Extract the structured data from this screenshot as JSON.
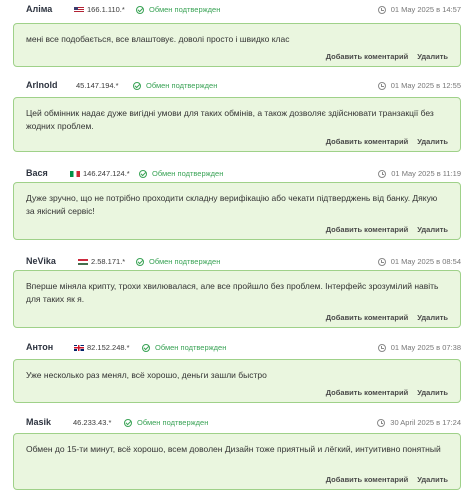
{
  "reviews": [
    {
      "name": "Аліма",
      "ip": "166.1.110.*",
      "flag": "us",
      "status": "Обмен подтвержден",
      "date": "01 May 2025 в 14:57",
      "text": "мені все подобається, все влаштовує. доволі просто і швидко клас",
      "add": "Добавить коментарий",
      "del": "Удалить"
    },
    {
      "name": "Arlnold",
      "ip": "45.147.194.*",
      "flag": "",
      "status": "Обмен подтвержден",
      "date": "01 May 2025 в 12:55",
      "text": "Цей обмінник надає дуже вигідні умови для таких обмінів, а також дозволяє здійснювати транзакції без жодних проблем.",
      "add": "Добавить коментарий",
      "del": "Удалить"
    },
    {
      "name": "Вася",
      "ip": "146.247.124.*",
      "flag": "it",
      "status": "Обмен подтвержден",
      "date": "01 May 2025 в 11:19",
      "text": "Дуже зручно, що не потрібно проходити складну верифікацію або чекати підтверджень від банку. Дякую за якісний сервіс!",
      "add": "Добавить коментарий",
      "del": "Удалить"
    },
    {
      "name": "NeVika",
      "ip": "2.58.171.*",
      "flag": "hu",
      "status": "Обмен подтвержден",
      "date": "01 May 2025 в 08:54",
      "text": "Вперше міняла крипту, трохи хвилювалася, але все пройшло без проблем. Інтерфейс зрозумілий навіть для таких як я.",
      "add": "Добавить коментарий",
      "del": "Удалить"
    },
    {
      "name": "Антон",
      "ip": "82.152.248.*",
      "flag": "gb",
      "status": "Обмен подтвержден",
      "date": "01 May 2025 в 07:38",
      "text": "Уже несколько раз менял, всё хорошо, деньги зашли быстро",
      "add": "Добавить коментарий",
      "del": "Удалить"
    },
    {
      "name": "Masik",
      "ip": "46.233.43.*",
      "flag": "",
      "status": "Обмен подтвержден",
      "date": "30 April 2025 в 17:24",
      "text": "Обмен до 15-ти минут, всё хорошо, всем доволен Дизайн тоже приятный и лёгкий, интуитивно понятный",
      "add": "Добавить коментарий",
      "del": "Удалить"
    }
  ]
}
